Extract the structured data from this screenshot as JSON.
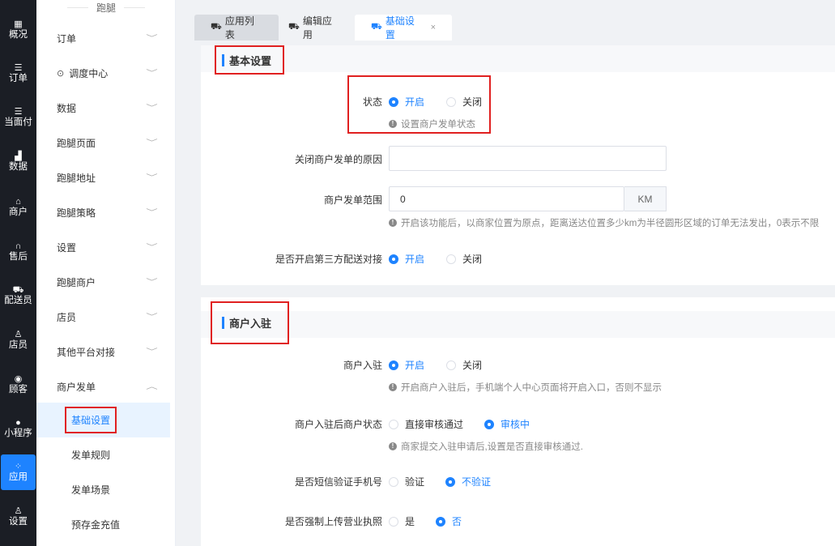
{
  "rail": [
    {
      "icon": "dashboard-icon",
      "glyph": "▦",
      "label": "概况"
    },
    {
      "icon": "list-icon",
      "glyph": "☰",
      "label": "订单"
    },
    {
      "icon": "list-icon",
      "glyph": "☰",
      "label": "当面付"
    },
    {
      "icon": "bar-chart-icon",
      "glyph": "▟",
      "label": "数据"
    },
    {
      "icon": "store-icon",
      "glyph": "⌂",
      "label": "商户"
    },
    {
      "icon": "headset-icon",
      "glyph": "∩",
      "label": "售后"
    },
    {
      "icon": "courier-icon",
      "glyph": "⛟",
      "label": "配送员"
    },
    {
      "icon": "staff-icon",
      "glyph": "♙",
      "label": "店员"
    },
    {
      "icon": "customer-icon",
      "glyph": "◉",
      "label": "顾客"
    },
    {
      "icon": "wechat-icon",
      "glyph": "●",
      "label": "小程序"
    },
    {
      "icon": "apps-icon",
      "glyph": "⁘",
      "label": "应用"
    },
    {
      "icon": "settings-user-icon",
      "glyph": "♙",
      "label": "设置"
    }
  ],
  "menu": {
    "title": "跑腿",
    "items": [
      {
        "label": "订单",
        "chevron": "﹀"
      },
      {
        "label": "调度中心",
        "chevron": "﹀",
        "pin": "⊙"
      },
      {
        "label": "数据",
        "chevron": "﹀"
      },
      {
        "label": "跑腿页面",
        "chevron": "﹀"
      },
      {
        "label": "跑腿地址",
        "chevron": "﹀"
      },
      {
        "label": "跑腿策略",
        "chevron": "﹀"
      },
      {
        "label": "设置",
        "chevron": "﹀"
      },
      {
        "label": "跑腿商户",
        "chevron": "﹀"
      },
      {
        "label": "店员",
        "chevron": "﹀"
      },
      {
        "label": "其他平台对接",
        "chevron": "﹀"
      },
      {
        "label": "商户发单",
        "chevron": "︿"
      }
    ],
    "sub_items": [
      "基础设置",
      "发单规则",
      "发单场景",
      "预存金充值"
    ]
  },
  "tabs": [
    {
      "label": "应用列表",
      "icon": "app-list-icon"
    },
    {
      "label": "编辑应用",
      "icon": "edit-app-icon"
    },
    {
      "label": "基础设置",
      "icon": "settings-tab-icon",
      "close": "×"
    }
  ],
  "basic": {
    "title": "基本设置",
    "status_label": "状态",
    "status_on": "开启",
    "status_off": "关闭",
    "status_hint": "设置商户发单状态",
    "close_reason_label": "关闭商户发单的原因",
    "close_reason_value": "",
    "range_label": "商户发单范围",
    "range_value": "0",
    "range_unit": "KM",
    "range_hint": "开启该功能后，以商家位置为原点，距离送达位置多少km为半径圆形区域的订单无法发出，0表示不限",
    "third_party_label": "是否开启第三方配送对接",
    "third_party_on": "开启",
    "third_party_off": "关闭"
  },
  "merchant": {
    "title": "商户入驻",
    "join_label": "商户入驻",
    "join_on": "开启",
    "join_off": "关闭",
    "join_hint": "开启商户入驻后，手机端个人中心页面将开启入口，否则不显示",
    "state_label": "商户入驻后商户状态",
    "state_direct": "直接审核通过",
    "state_review": "审核中",
    "state_hint": "商家提交入驻申请后,设置是否直接审核通过.",
    "sms_label": "是否短信验证手机号",
    "sms_yes": "验证",
    "sms_no": "不验证",
    "license_label": "是否强制上传营业执照",
    "license_yes": "是",
    "license_no": "否"
  },
  "info_glyph": "!"
}
